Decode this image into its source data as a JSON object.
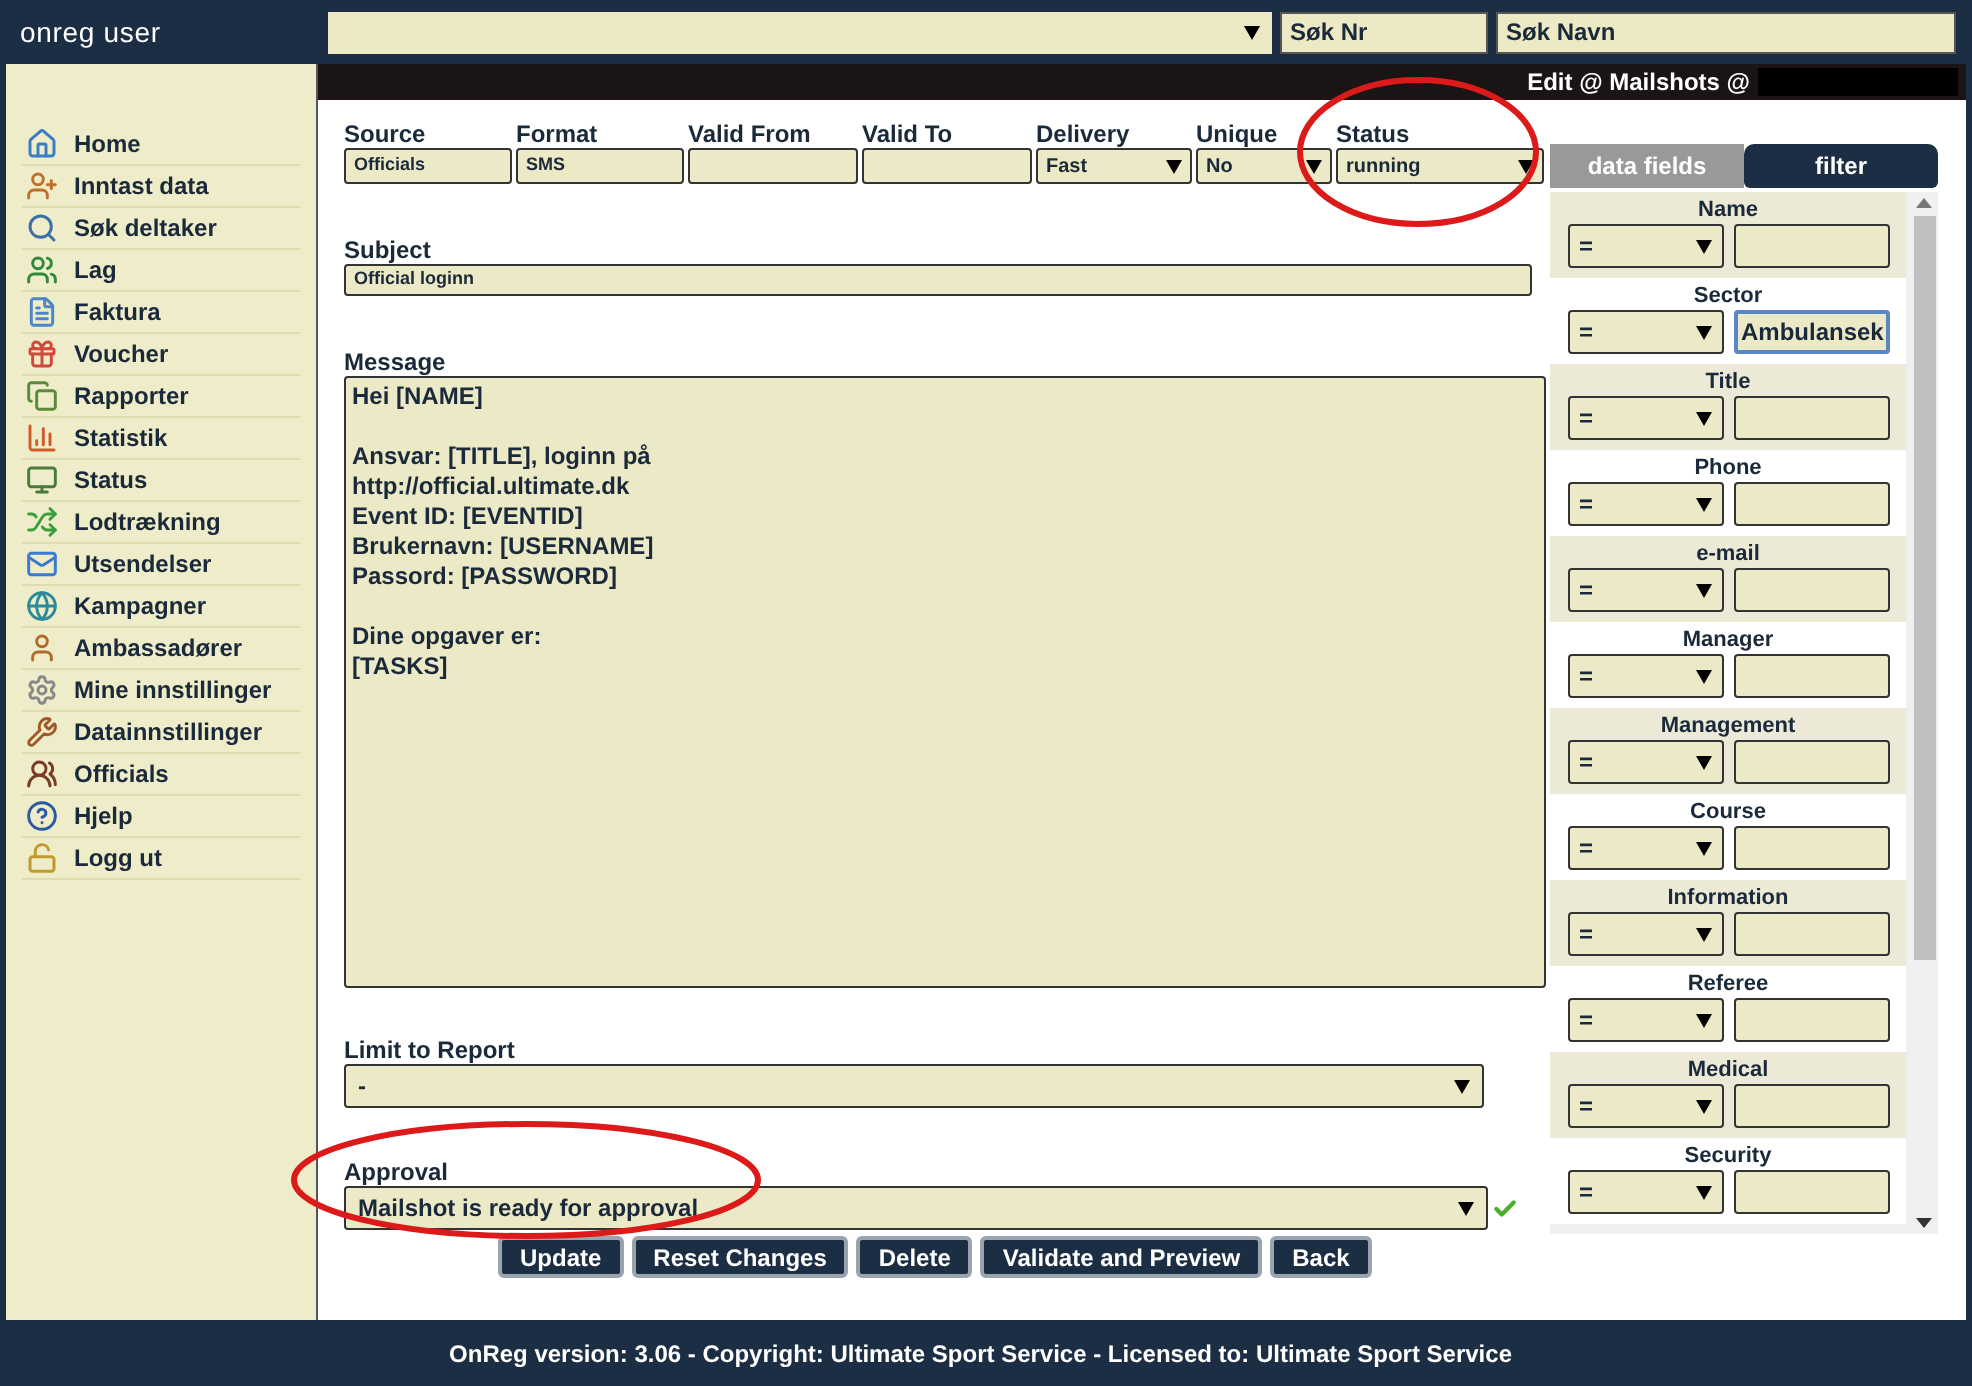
{
  "header": {
    "user": "onreg user",
    "search_nr": "Søk Nr",
    "search_name": "Søk Navn"
  },
  "sidebar": {
    "items": [
      {
        "label": "Home"
      },
      {
        "label": "Inntast data"
      },
      {
        "label": "Søk deltaker"
      },
      {
        "label": "Lag"
      },
      {
        "label": "Faktura"
      },
      {
        "label": "Voucher"
      },
      {
        "label": "Rapporter"
      },
      {
        "label": "Statistik"
      },
      {
        "label": "Status"
      },
      {
        "label": "Lodtrækning"
      },
      {
        "label": "Utsendelser"
      },
      {
        "label": "Kampagner"
      },
      {
        "label": "Ambassadører"
      },
      {
        "label": "Mine innstillinger"
      },
      {
        "label": "Datainnstillinger"
      },
      {
        "label": "Officials"
      },
      {
        "label": "Hjelp"
      },
      {
        "label": "Logg ut"
      }
    ]
  },
  "page_title": "Edit @ Mailshots @",
  "fields": [
    {
      "label": "Source",
      "value": "Officials",
      "kind": "text"
    },
    {
      "label": "Format",
      "value": "SMS",
      "kind": "text"
    },
    {
      "label": "Valid From",
      "kind": "text"
    },
    {
      "label": "Valid To",
      "kind": "text"
    },
    {
      "label": "Delivery",
      "value": "Fast",
      "kind": "select"
    },
    {
      "label": "Unique",
      "value": "No",
      "kind": "select"
    },
    {
      "label": "Status",
      "value": "running",
      "kind": "select"
    }
  ],
  "subject": {
    "label": "Subject",
    "value": "Official loginn"
  },
  "message": {
    "label": "Message",
    "value": "Hei [NAME]\n\nAnsvar: [TITLE], loginn på\nhttp://official.ultimate.dk\nEvent ID: [EVENTID]\nBrukernavn: [USERNAME]\nPassord: [PASSWORD]\n\nDine opgaver er:\n[TASKS]"
  },
  "limit_to_report": {
    "label": "Limit to Report",
    "value": "-"
  },
  "approval": {
    "label": "Approval",
    "value": "Mailshot is ready for approval",
    "valid": true
  },
  "buttons": [
    "Update",
    "Reset Changes",
    "Delete",
    "Validate and Preview",
    "Back"
  ],
  "tabs": [
    {
      "label": "data fields",
      "selected": false
    },
    {
      "label": "filter",
      "selected": true
    }
  ],
  "filters": [
    {
      "label": "Name",
      "operator": "=",
      "focused": false
    },
    {
      "label": "Sector",
      "operator": "=",
      "value": "Ambulansek",
      "focused": true
    },
    {
      "label": "Title",
      "operator": "=",
      "focused": false
    },
    {
      "label": "Phone",
      "operator": "=",
      "focused": false
    },
    {
      "label": "e-mail",
      "operator": "=",
      "focused": false
    },
    {
      "label": "Manager",
      "operator": "=",
      "focused": false
    },
    {
      "label": "Management",
      "operator": "=",
      "focused": false
    },
    {
      "label": "Course",
      "operator": "=",
      "focused": false
    },
    {
      "label": "Information",
      "operator": "=",
      "focused": false
    },
    {
      "label": "Referee",
      "operator": "=",
      "focused": false
    },
    {
      "label": "Medical",
      "operator": "=",
      "focused": false
    },
    {
      "label": "Security",
      "operator": "=",
      "focused": false
    }
  ],
  "footer": "OnReg version: 3.06 - Copyright: Ultimate Sport Service - Licensed to: Ultimate Sport Service"
}
